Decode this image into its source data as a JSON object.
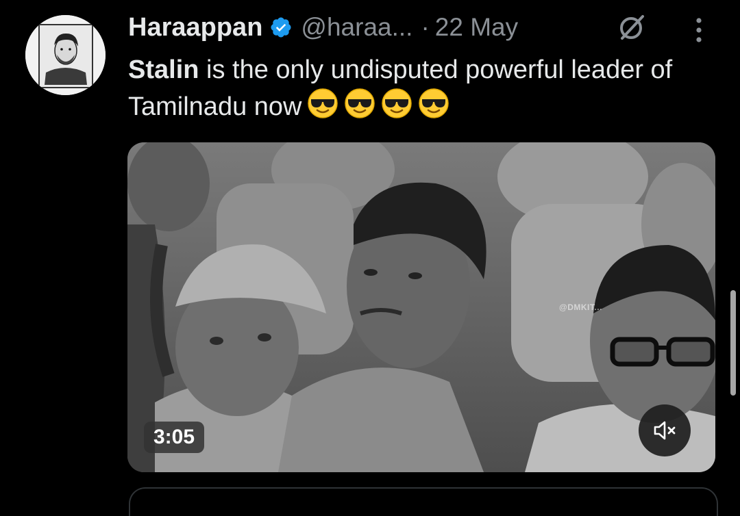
{
  "tweet": {
    "author": {
      "display_name": "Haraappan",
      "handle": "@haraa...",
      "verified": true,
      "avatar_icon": "profile-photo"
    },
    "separator": "·",
    "date": "22 May",
    "text_bold": "Stalin",
    "text_rest": " is the only undisputed powerful leader of Tamilnadu now",
    "emojis": [
      "😎",
      "😎",
      "😎",
      "😎"
    ],
    "actions": {
      "grok_icon": "grok-slash-icon",
      "more_icon": "more-vertical-icon"
    }
  },
  "media": {
    "type": "video",
    "duration": "3:05",
    "watermark": "@DMKIT...",
    "mute_icon": "speaker-muted-icon"
  },
  "colors": {
    "background": "#000000",
    "text": "#e7e9ea",
    "secondary_text": "#8b9096",
    "verified_badge": "#1d9bf0"
  }
}
